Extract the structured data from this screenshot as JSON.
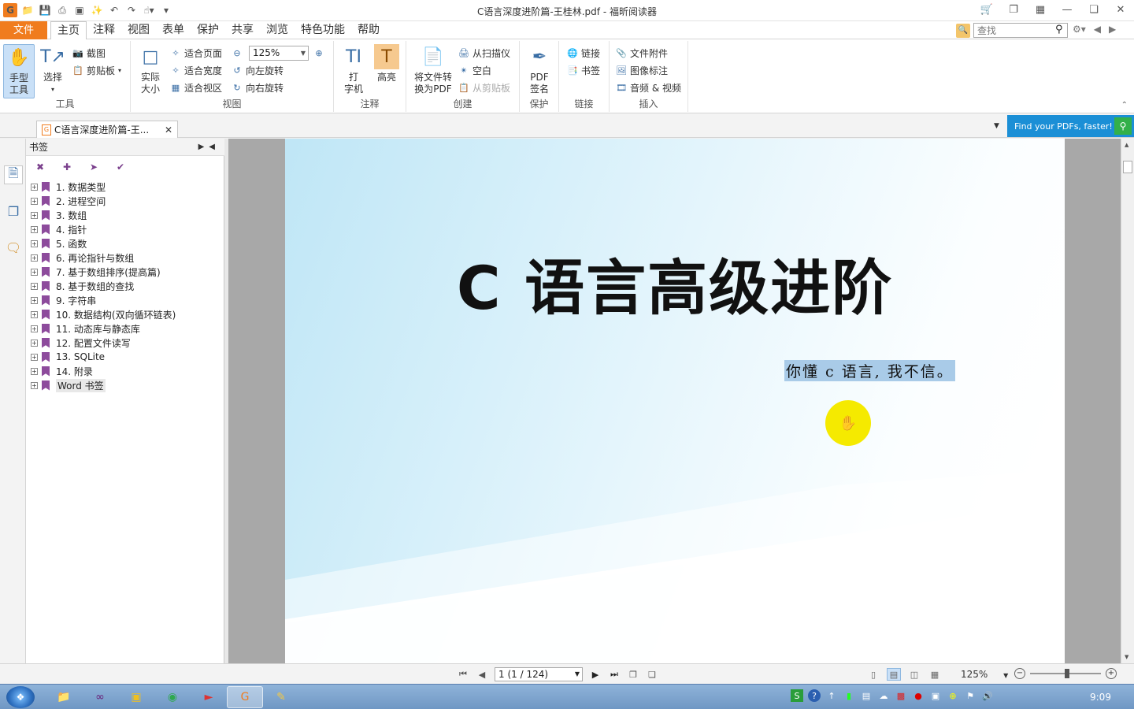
{
  "window": {
    "title": "C语言深度进阶篇-王桂林.pdf - 福昕阅读器"
  },
  "menu": {
    "file_label": "文件",
    "tabs": [
      "主页",
      "注释",
      "视图",
      "表单",
      "保护",
      "共享",
      "浏览",
      "特色功能",
      "帮助"
    ],
    "active_tab": "主页",
    "search_placeholder": "查找"
  },
  "ribbon": {
    "tools": {
      "group_label": "工具",
      "hand_label": "手型\n工具",
      "hand_line1": "手型",
      "hand_line2": "工具",
      "select_label": "选择",
      "screenshot_label": "截图",
      "clipboard_label": "剪贴板"
    },
    "view": {
      "group_label": "视图",
      "actual_size_line1": "实际",
      "actual_size_line2": "大小",
      "fit_page": "适合页面",
      "fit_width": "适合宽度",
      "fit_visible": "适合视区",
      "zoom_value": "125%",
      "rotate_left": "向左旋转",
      "rotate_right": "向右旋转"
    },
    "comment": {
      "group_label": "注释",
      "typewriter_line1": "打",
      "typewriter_line2": "字机",
      "highlight_label": "高亮"
    },
    "create": {
      "group_label": "创建",
      "convert_line1": "将文件转",
      "convert_line2": "换为PDF",
      "from_scanner": "从扫描仪",
      "blank": "空白",
      "from_clipboard": "从剪贴板"
    },
    "protect": {
      "group_label": "保护",
      "sign_line1": "PDF",
      "sign_line2": "签名"
    },
    "links": {
      "group_label": "链接",
      "link_label": "链接",
      "bookmark_label": "书签"
    },
    "insert": {
      "group_label": "插入",
      "attachment": "文件附件",
      "image_annot": "图像标注",
      "audio_video": "音频 & 视频"
    }
  },
  "doc_tab": {
    "label": "C语言深度进阶篇-王...",
    "ad_text": "Find your PDFs, faster!"
  },
  "bookmarks": {
    "header": "书签",
    "items": [
      "1. 数据类型",
      "2. 进程空间",
      "3. 数组",
      "4. 指针",
      "5. 函数",
      "6. 再论指针与数组",
      "7. 基于数组排序(提高篇)",
      "8. 基于数组的查找",
      "9. 字符串",
      "10. 数据结构(双向循环链表)",
      "11. 动态库与静态库",
      "12. 配置文件读写",
      "13. SQLite",
      "14. 附录",
      "Word 书签"
    ],
    "selected_index": 14
  },
  "page": {
    "title": "C 语言高级进阶",
    "subtitle": "你懂 c 语言, 我不信。"
  },
  "status": {
    "page_display": "1 (1 / 124)",
    "zoom": "125%"
  },
  "taskbar": {
    "clock": "9:09"
  }
}
